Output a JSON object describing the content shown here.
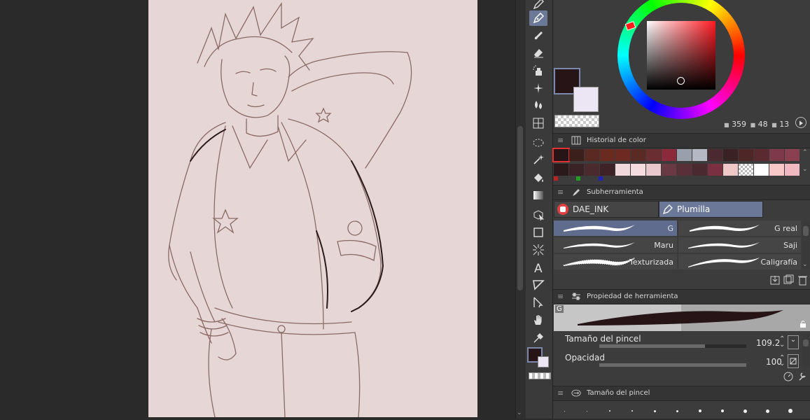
{
  "colors": {
    "main_color": "#261417",
    "sub_color": "#ece6f4",
    "accent": "#6b7898",
    "panel_bg": "#3c3c3c",
    "paper": "#e6d6d6"
  },
  "color_wheel": {
    "readout": {
      "h": "359",
      "s": "48",
      "v": "13"
    }
  },
  "panels": {
    "color_history": {
      "title": "Historial de color"
    },
    "sub_tool": {
      "title": "Subherramienta",
      "tabs": [
        {
          "label": "DAE_INK",
          "icon": "ink-set-icon"
        },
        {
          "label": "Plumilla",
          "icon": "nib-icon",
          "selected": true
        }
      ],
      "brushes": [
        {
          "label": "G",
          "selected": true
        },
        {
          "label": "G real"
        },
        {
          "label": "Maru"
        },
        {
          "label": "Saji"
        },
        {
          "label": "Texturizada"
        },
        {
          "label": "Caligrafía"
        }
      ]
    },
    "tool_property": {
      "title": "Propiedad de herramienta",
      "preview_tag": "G",
      "brush_size": {
        "label": "Tamaño del pincel",
        "value": "109.2",
        "fill": 0.72
      },
      "opacity": {
        "label": "Opacidad",
        "value": "100",
        "fill": 1.0
      }
    },
    "brush_size_panel": {
      "title": "Tamaño del pincel"
    }
  },
  "history_swatches_row1": [
    "#261417",
    "#3a1f1c",
    "#5a2a22",
    "#6a2a20",
    "#6e2a22",
    "#5a2a24",
    "#6a2e32",
    "#8a2a3a",
    "#9aa0ab",
    "#b5b8c2",
    "#4a2a30",
    "#3a2224",
    "#4e2628",
    "#5a2a30",
    "#7e3a4a",
    "#8a4050"
  ],
  "history_swatches_row2": [
    "#2a1a1c",
    "#3a2226",
    "#4a2a2c",
    "#3e2228",
    "#f0d8dc",
    "#f4dce0",
    "#e8c8cc",
    "#6a3a44",
    "#5a3038",
    "#4a2a30",
    "#7a3040",
    "#f0c8c8",
    "checker",
    "#ffffff",
    "#f8c8c8",
    "#f0b8c0"
  ],
  "history_mini": [
    "#c02020",
    "#20a020",
    "#2020c0"
  ]
}
